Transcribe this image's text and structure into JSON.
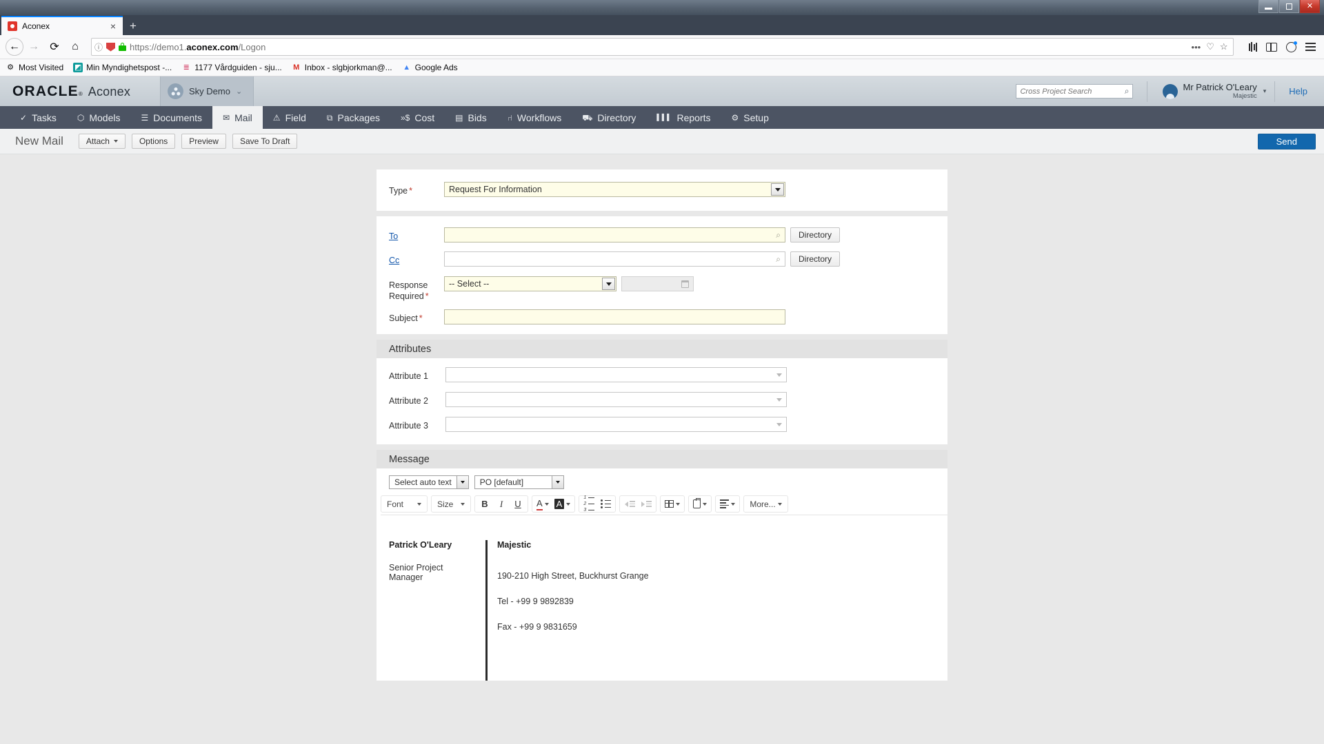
{
  "window": {
    "minimize_label": "Minimize",
    "maximize_label": "Restore",
    "close_label": "Close"
  },
  "browser": {
    "tab": {
      "title": "Aconex",
      "close_label": "×",
      "favicon": "aconex-favicon"
    },
    "new_tab_label": "+",
    "nav": {
      "back_label": "←",
      "forward_label": "→",
      "reload_label": "⟳",
      "home_label": "⌂"
    },
    "url": {
      "scheme": "https://demo1.",
      "domain": "aconex.com",
      "path": "/Logon",
      "full": "https://demo1.aconex.com/Logon",
      "info_icon": "ⓘ",
      "tracking_icon": "shield-icon",
      "lock_icon": "lock-icon",
      "more_label": "•••",
      "pocket_label": "Save to Pocket",
      "bookmark_label": "☆"
    },
    "toolbar_right": [
      {
        "name": "library-icon",
        "label": "Library"
      },
      {
        "name": "sidebar-icon",
        "label": "Sidebars"
      },
      {
        "name": "account-icon",
        "label": "Account"
      },
      {
        "name": "menu-icon",
        "label": "Open menu"
      }
    ],
    "bookmarks": [
      {
        "label": "Most Visited",
        "icon": "gear-icon",
        "glyph": "⚙"
      },
      {
        "label": "Min Myndighetspost -...",
        "icon": "myndighetspost-icon",
        "glyph": "◰"
      },
      {
        "label": "1177 Vårdguiden - sju...",
        "icon": "vardguiden-icon",
        "glyph": "≡"
      },
      {
        "label": "Inbox - slgbjorkman@...",
        "icon": "gmail-icon",
        "glyph": "M"
      },
      {
        "label": "Google Ads",
        "icon": "google-ads-icon",
        "glyph": "▲"
      }
    ]
  },
  "app_header": {
    "brand_oracle": "ORACLE",
    "brand_reg": "®",
    "brand_product": "Aconex",
    "project": {
      "name": "Sky Demo",
      "avatar_icon": "project-avatar-icon",
      "chevron": "⌄"
    },
    "search": {
      "placeholder": "Cross Project Search",
      "value": "",
      "icon": "search-icon"
    },
    "user": {
      "name": "Mr Patrick O'Leary",
      "org": "Majestic",
      "avatar_icon": "user-avatar-icon",
      "chevron": "▾"
    },
    "help_label": "Help"
  },
  "main_nav": {
    "active": "Mail",
    "items": [
      {
        "label": "Tasks",
        "icon": "check-icon",
        "glyph": "✓"
      },
      {
        "label": "Models",
        "icon": "cube-icon",
        "glyph": "⬡"
      },
      {
        "label": "Documents",
        "icon": "document-icon",
        "glyph": "☰"
      },
      {
        "label": "Mail",
        "icon": "envelope-icon",
        "glyph": "✉"
      },
      {
        "label": "Field",
        "icon": "warning-icon",
        "glyph": "⚠"
      },
      {
        "label": "Packages",
        "icon": "packages-icon",
        "glyph": "⧉"
      },
      {
        "label": "Cost",
        "icon": "cost-icon",
        "glyph": "»$"
      },
      {
        "label": "Bids",
        "icon": "bids-icon",
        "glyph": "▤"
      },
      {
        "label": "Workflows",
        "icon": "workflow-icon",
        "glyph": "⑁"
      },
      {
        "label": "Directory",
        "icon": "people-icon",
        "glyph": "⛟"
      },
      {
        "label": "Reports",
        "icon": "bar-chart-icon",
        "glyph": "█"
      },
      {
        "label": "Setup",
        "icon": "gear-icon",
        "glyph": "⚙"
      }
    ]
  },
  "action_bar": {
    "page_title": "New Mail",
    "attach_label": "Attach",
    "options_label": "Options",
    "preview_label": "Preview",
    "save_draft_label": "Save To Draft",
    "send_label": "Send",
    "send_color": "#1267ad"
  },
  "form": {
    "type": {
      "label": "Type",
      "required": "*",
      "value": "Request For Information"
    },
    "to": {
      "label": "To",
      "value": "",
      "directory_label": "Directory",
      "search_icon": "search-icon"
    },
    "cc": {
      "label": "Cc",
      "value": "",
      "directory_label": "Directory",
      "search_icon": "search-icon"
    },
    "response_required": {
      "label_line1": "Response",
      "label_line2": "Required",
      "required": "*",
      "value": "-- Select --",
      "date_value": "",
      "calendar_icon": "calendar-icon"
    },
    "subject": {
      "label": "Subject",
      "required": "*",
      "value": ""
    },
    "attributes": {
      "section_title": "Attributes",
      "rows": [
        {
          "label": "Attribute 1",
          "value": ""
        },
        {
          "label": "Attribute 2",
          "value": ""
        },
        {
          "label": "Attribute 3",
          "value": ""
        }
      ]
    },
    "message": {
      "section_title": "Message",
      "auto_text": {
        "value": "Select auto text"
      },
      "template": {
        "value": "PO [default]"
      },
      "toolbar": {
        "font_label": "Font",
        "size_label": "Size",
        "bold_label": "B",
        "italic_label": "I",
        "underline_label": "U",
        "text_color_label": "A",
        "highlight_label": "A",
        "numbered_list_label": "Numbered list",
        "bulleted_list_label": "Bulleted list",
        "outdent_label": "Decrease indent",
        "indent_label": "Increase indent",
        "table_label": "Table",
        "paste_label": "Paste",
        "align_label": "Align",
        "more_label": "More..."
      },
      "signature": {
        "name": "Patrick O'Leary",
        "role": "Senior Project Manager",
        "org": "Majestic",
        "address": "190-210 High Street, Buckhurst Grange",
        "tel": "Tel - +99 9 9892839",
        "fax": "Fax - +99 9 9831659"
      }
    }
  }
}
